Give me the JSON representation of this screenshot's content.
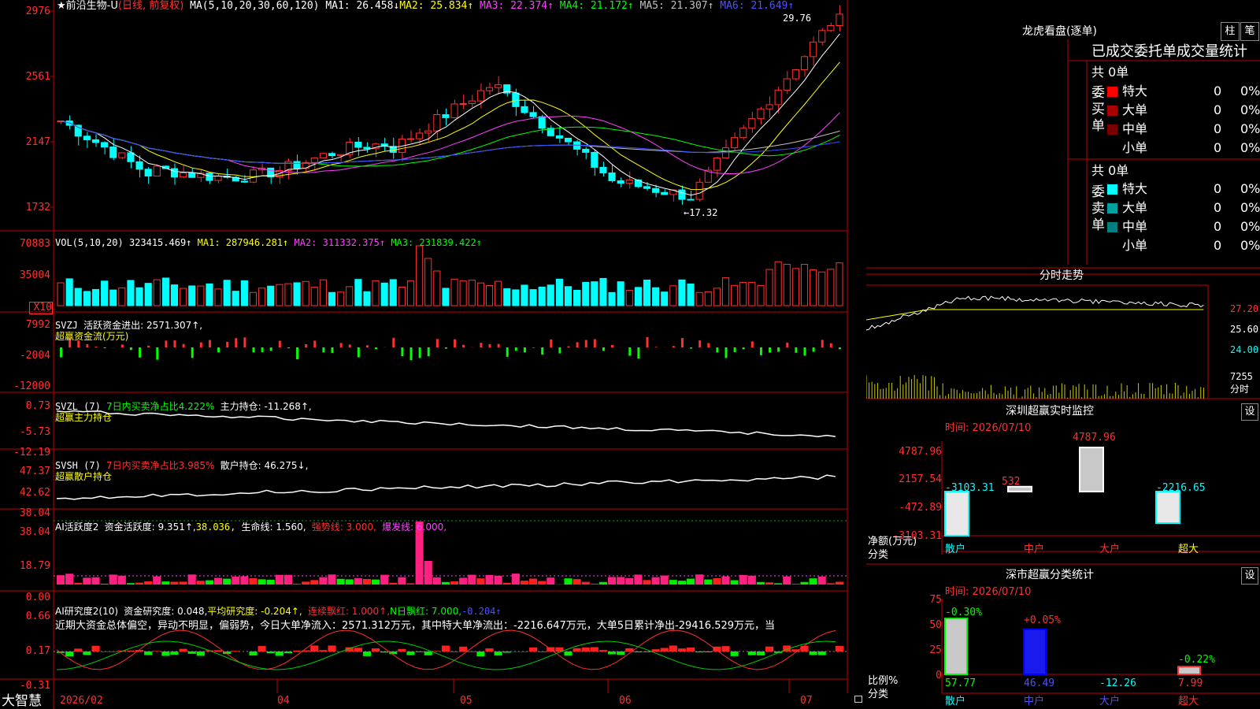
{
  "app_name": "大智慧",
  "main_header": {
    "prefix": "★前沿生物-U",
    "period": "(日线, 前复权)",
    "ma_def": "MA(5,10,20,30,60,120)",
    "ma1": "MA1: 26.458↓",
    "ma2": "MA2: 25.834↑",
    "ma3": "MA3: 22.374↑",
    "ma4": "MA4: 21.172↑",
    "ma5": "MA5: 21.307↑",
    "ma6": "MA6: 21.649↑"
  },
  "price_axis": [
    "2976",
    "2561",
    "2147",
    "1732"
  ],
  "price_annotations": {
    "high": "29.76",
    "low": "17.32"
  },
  "vol_header": {
    "def": "VOL(5,10,20)",
    "v": "323415.469↑",
    "ma1": "MA1: 287946.281↑",
    "ma2": "MA2: 311332.375↑",
    "ma3": "MA3: 231839.422↑"
  },
  "vol_axis": [
    "70883",
    "35004",
    "X10"
  ],
  "svzj_header": {
    "def": "SVZJ",
    "text": "活跃资金进出: 2571.307↑,",
    "sub": "超赢资金流(万元)"
  },
  "svzj_axis": [
    "7992",
    "-2004",
    "-12000"
  ],
  "svzl_header": {
    "def": "SVZL (7)",
    "ratio": "7日内买卖净占比4.222%",
    "main": "主力持仓: -11.268↑,",
    "sub": "超赢主力持仓"
  },
  "svzl_axis": [
    "0.73",
    "-5.73",
    "-12.19"
  ],
  "svsh_header": {
    "def": "SVSH (7)",
    "ratio": "7日内买卖净占比3.985%",
    "main": "散户持仓: 46.275↓,",
    "sub": "超赢散户持仓"
  },
  "svsh_axis": [
    "47.37",
    "42.62",
    "38.04"
  ],
  "ai1_header": {
    "def": "AI活跃度2",
    "a": "资金活跃度: 9.351↑,",
    "b": "38.036,",
    "c": "生命线: 1.560,",
    "d": "强势线: 3.000,",
    "e": "爆发线: 6.000,"
  },
  "ai1_axis": [
    "38.04",
    "18.79",
    "0.00"
  ],
  "ai2_header": {
    "def": "AI研究度2(10)",
    "a": "资金研究度: 0.048,",
    "b": "平均研究度: -0.204↑,",
    "c": "连续飘红: 1.000↑,",
    "d": "N日飘红: 7.000,",
    "e": "-0.204↑"
  },
  "ai2_comment": "近期大资金总体偏空，异动不明显，偏弱势，今日大单净流入：2571.312万元，其中特大单净流出：-2216.647万元，大单5日累计净出-29416.529万元，当",
  "ai2_axis": [
    "0.66",
    "0.17",
    "-0.31"
  ],
  "date_axis": [
    "2026/02",
    "04",
    "05",
    "06",
    "07"
  ],
  "longhu": {
    "title": "龙虎看盘(逐单)",
    "btn1": "柱",
    "btn2": "笔",
    "header": "已成交委托单成交量统计",
    "buy_label": "委买单",
    "sell_label": "委卖单",
    "buy_total": "共 0单",
    "sell_total": "共 0单",
    "rows_buy": [
      {
        "name": "特大",
        "count": "0",
        "pct": "0%",
        "color": "#ff0000"
      },
      {
        "name": "大单",
        "count": "0",
        "pct": "0%",
        "color": "#aa0000"
      },
      {
        "name": "中单",
        "count": "0",
        "pct": "0%",
        "color": "#7a0000"
      },
      {
        "name": "小单",
        "count": "0",
        "pct": "0%",
        "color": "#000000"
      }
    ],
    "rows_sell": [
      {
        "name": "特大",
        "count": "0",
        "pct": "0%",
        "color": "#00ffff"
      },
      {
        "name": "大单",
        "count": "0",
        "pct": "0%",
        "color": "#00a0a0"
      },
      {
        "name": "中单",
        "count": "0",
        "pct": "0%",
        "color": "#008080"
      },
      {
        "name": "小单",
        "count": "0",
        "pct": "0%",
        "color": "#000000"
      }
    ]
  },
  "intraday": {
    "title": "分时走势",
    "axis": [
      "27.20",
      "25.60",
      "24.00",
      "7255",
      "分时"
    ]
  },
  "monitor": {
    "title": "深圳超赢实时监控",
    "btn": "设",
    "time": "时间: 2026/07/10",
    "axis": [
      "4787.96",
      "2157.54",
      "-472.89",
      "-3103.31"
    ],
    "ylabel": "净额(万元)",
    "xlabel": "分类",
    "categories": [
      "散户",
      "中户",
      "大户",
      "超大"
    ],
    "value_labels": [
      "-3103.31",
      "532",
      "4787.96",
      "-2216.65"
    ]
  },
  "classify": {
    "title": "深市超赢分类统计",
    "btn": "设",
    "time": "时间: 2026/07/10",
    "axis": [
      "75",
      "50",
      "25",
      "0"
    ],
    "ylabel": "比例%",
    "xlabel": "分类",
    "categories": [
      "散户",
      "中户",
      "大户",
      "超大"
    ],
    "top_labels": [
      "-0.30%",
      "+0.05%",
      "",
      "-0.22%"
    ],
    "bottom_labels": [
      "57.77",
      "46.49",
      "-12.26",
      "7.99"
    ]
  },
  "chart_data": [
    {
      "type": "bar",
      "title": "深圳超赢实时监控",
      "ylabel": "净额(万元)",
      "xlabel": "分类",
      "categories": [
        "散户",
        "中户",
        "大户",
        "超大"
      ],
      "values": [
        -3103.31,
        532,
        4787.96,
        -2216.65
      ],
      "ylim": [
        -3103.31,
        4787.96
      ]
    },
    {
      "type": "bar",
      "title": "深市超赢分类统计",
      "ylabel": "比例%",
      "xlabel": "分类",
      "categories": [
        "散户",
        "中户",
        "大户",
        "超大"
      ],
      "values": [
        57.77,
        46.49,
        -12.26,
        7.99
      ],
      "ylim": [
        0,
        75
      ]
    }
  ],
  "colors": {
    "up": "#ff3030",
    "down": "#00ffff",
    "grid": "#c00000",
    "ma1": "#ffffff",
    "ma2": "#ffff00",
    "ma3": "#ff40ff",
    "ma4": "#00ff00",
    "ma5": "#c0c0c0",
    "ma6": "#3050ff"
  }
}
